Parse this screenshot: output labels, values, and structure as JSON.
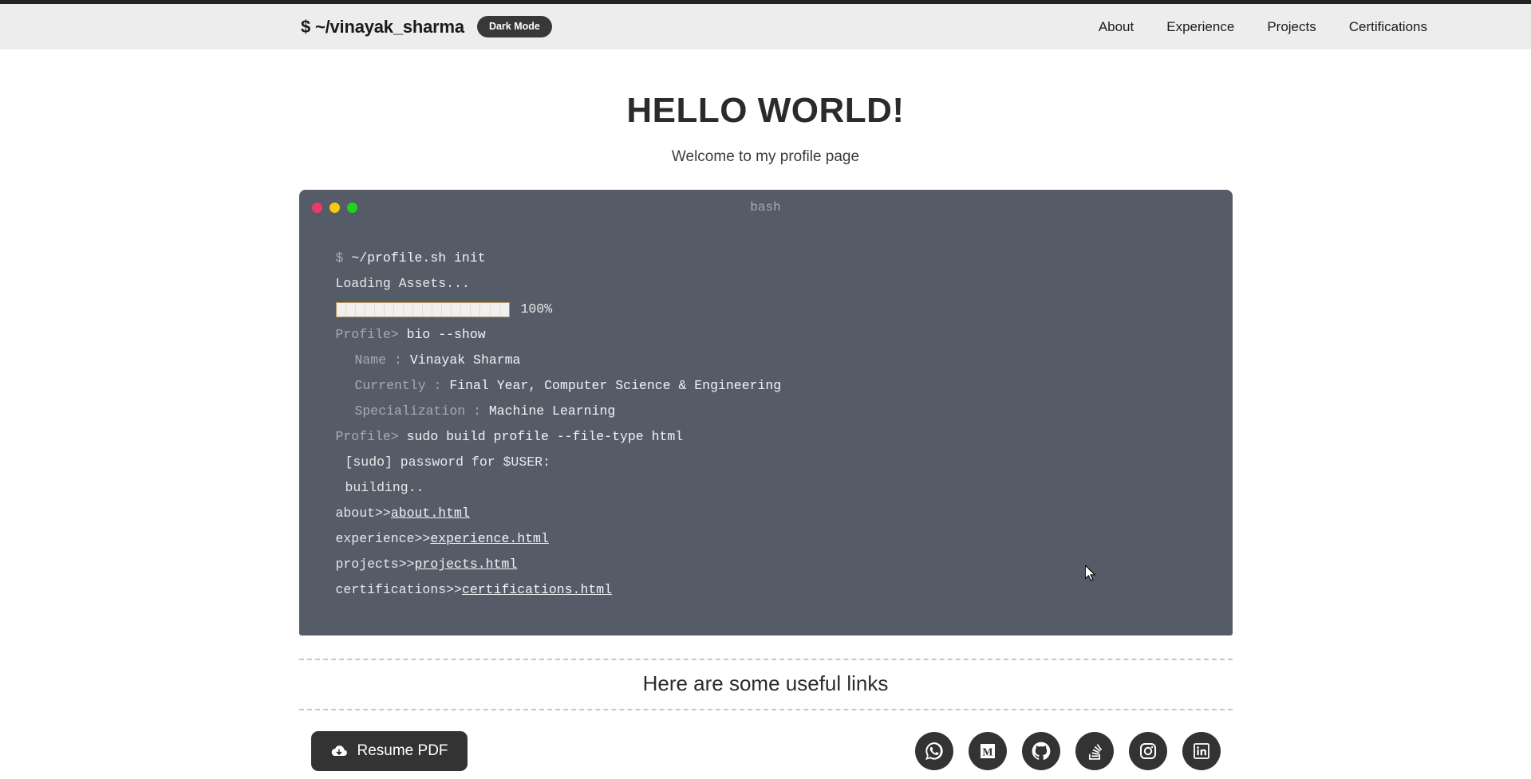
{
  "header": {
    "brand": "$ ~/vinayak_sharma",
    "theme_toggle_label": "Dark Mode",
    "nav": [
      {
        "label": "About"
      },
      {
        "label": "Experience"
      },
      {
        "label": "Projects"
      },
      {
        "label": "Certifications"
      }
    ]
  },
  "hero": {
    "title": "HELLO WORLD!",
    "subtitle": "Welcome to my profile page"
  },
  "terminal": {
    "window_title": "bash",
    "traffic_lights": [
      "close-red",
      "minimize-yellow",
      "maximize-green"
    ],
    "prompt_line": {
      "symbol": "$",
      "command": "~/profile.sh init"
    },
    "loading_text": "Loading Assets...",
    "progress": {
      "percent": "100%",
      "value": 100,
      "segments": 18
    },
    "bio_command": {
      "prompt": "Profile>",
      "command": "bio --show"
    },
    "bio": [
      {
        "label": "Name :",
        "value": "Vinayak Sharma"
      },
      {
        "label": "Currently :",
        "value": "Final Year, Computer Science & Engineering"
      },
      {
        "label": "Specialization :",
        "value": "Machine Learning"
      }
    ],
    "build_command": {
      "prompt": "Profile>",
      "command": "sudo build profile --file-type html"
    },
    "sudo_line": "[sudo] password for $USER:",
    "building_line": "building..",
    "outputs": [
      {
        "name": "about>>",
        "file": "about.html"
      },
      {
        "name": "experience>>",
        "file": "experience.html"
      },
      {
        "name": "projects>>",
        "file": "projects.html"
      },
      {
        "name": "certifications>>",
        "file": "certifications.html"
      }
    ],
    "colors": {
      "background": "#565b68",
      "text": "#e8e8ea",
      "dim_text": "#a7aab3"
    }
  },
  "links_section": {
    "heading": "Here are some useful links"
  },
  "footer": {
    "resume_label": "Resume PDF",
    "resume_icon": "cloud-download-icon",
    "socials": [
      {
        "name": "whatsapp"
      },
      {
        "name": "medium"
      },
      {
        "name": "github"
      },
      {
        "name": "stackoverflow"
      },
      {
        "name": "instagram"
      },
      {
        "name": "linkedin"
      }
    ]
  },
  "colors": {
    "header_bg": "#ededed",
    "page_bg": "#ffffff",
    "accent_dark": "#333333",
    "terminal_bg": "#565b68"
  }
}
